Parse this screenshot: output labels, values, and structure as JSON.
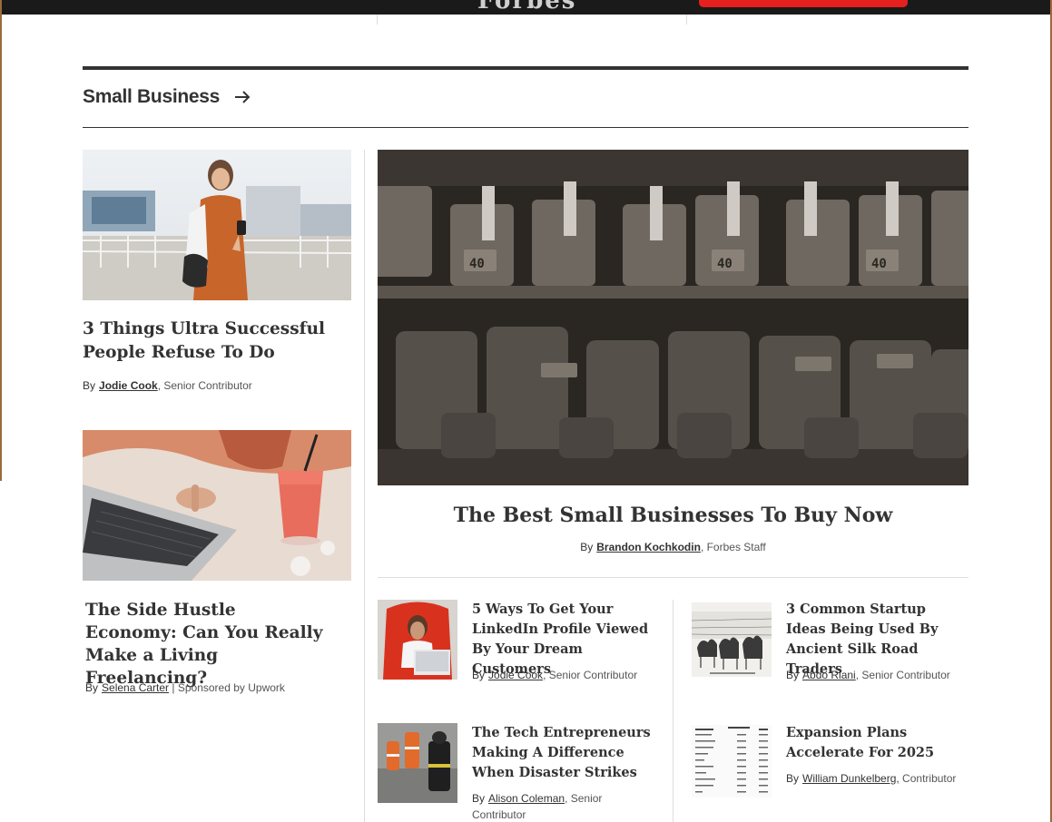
{
  "header": {
    "logo": "Forbes"
  },
  "section": {
    "title": "Small Business"
  },
  "left_articles": [
    {
      "title": "3 Things Ultra Successful People Refuse To Do",
      "by": "By",
      "author": "Jodie Cook",
      "role": ", Senior Contributor"
    },
    {
      "title": "The Side Hustle Economy: Can You Really Make a Living Freelancing?",
      "by": "By",
      "author": "Selena Carter",
      "role": " | Sponsored by Upwork"
    }
  ],
  "feature": {
    "title": "The Best Small Businesses To Buy Now",
    "by": "By",
    "author": "Brandon Kochkodin",
    "role": ", Forbes Staff"
  },
  "grid": [
    {
      "title": "5 Ways To Get Your LinkedIn Profile Viewed By Your Dream Customers",
      "by": "By",
      "author": "Jodie Cook",
      "role": ", Senior Contributor"
    },
    {
      "title": "3 Common Startup Ideas Being Used By Ancient Silk Road Traders",
      "by": "By",
      "author": "Abdo Riani",
      "role": ", Senior Contributor"
    },
    {
      "title": "The Tech Entrepreneurs Making A Difference When Disaster Strikes",
      "by": "By",
      "author": "Alison Coleman",
      "role": ", Senior",
      "role2": "Contributor"
    },
    {
      "title": "Expansion Plans Accelerate For 2025",
      "by": "By",
      "author": "William Dunkelberg,",
      "role": " Contributor"
    }
  ],
  "dumbbell_labels": [
    "40",
    "40",
    "40"
  ]
}
